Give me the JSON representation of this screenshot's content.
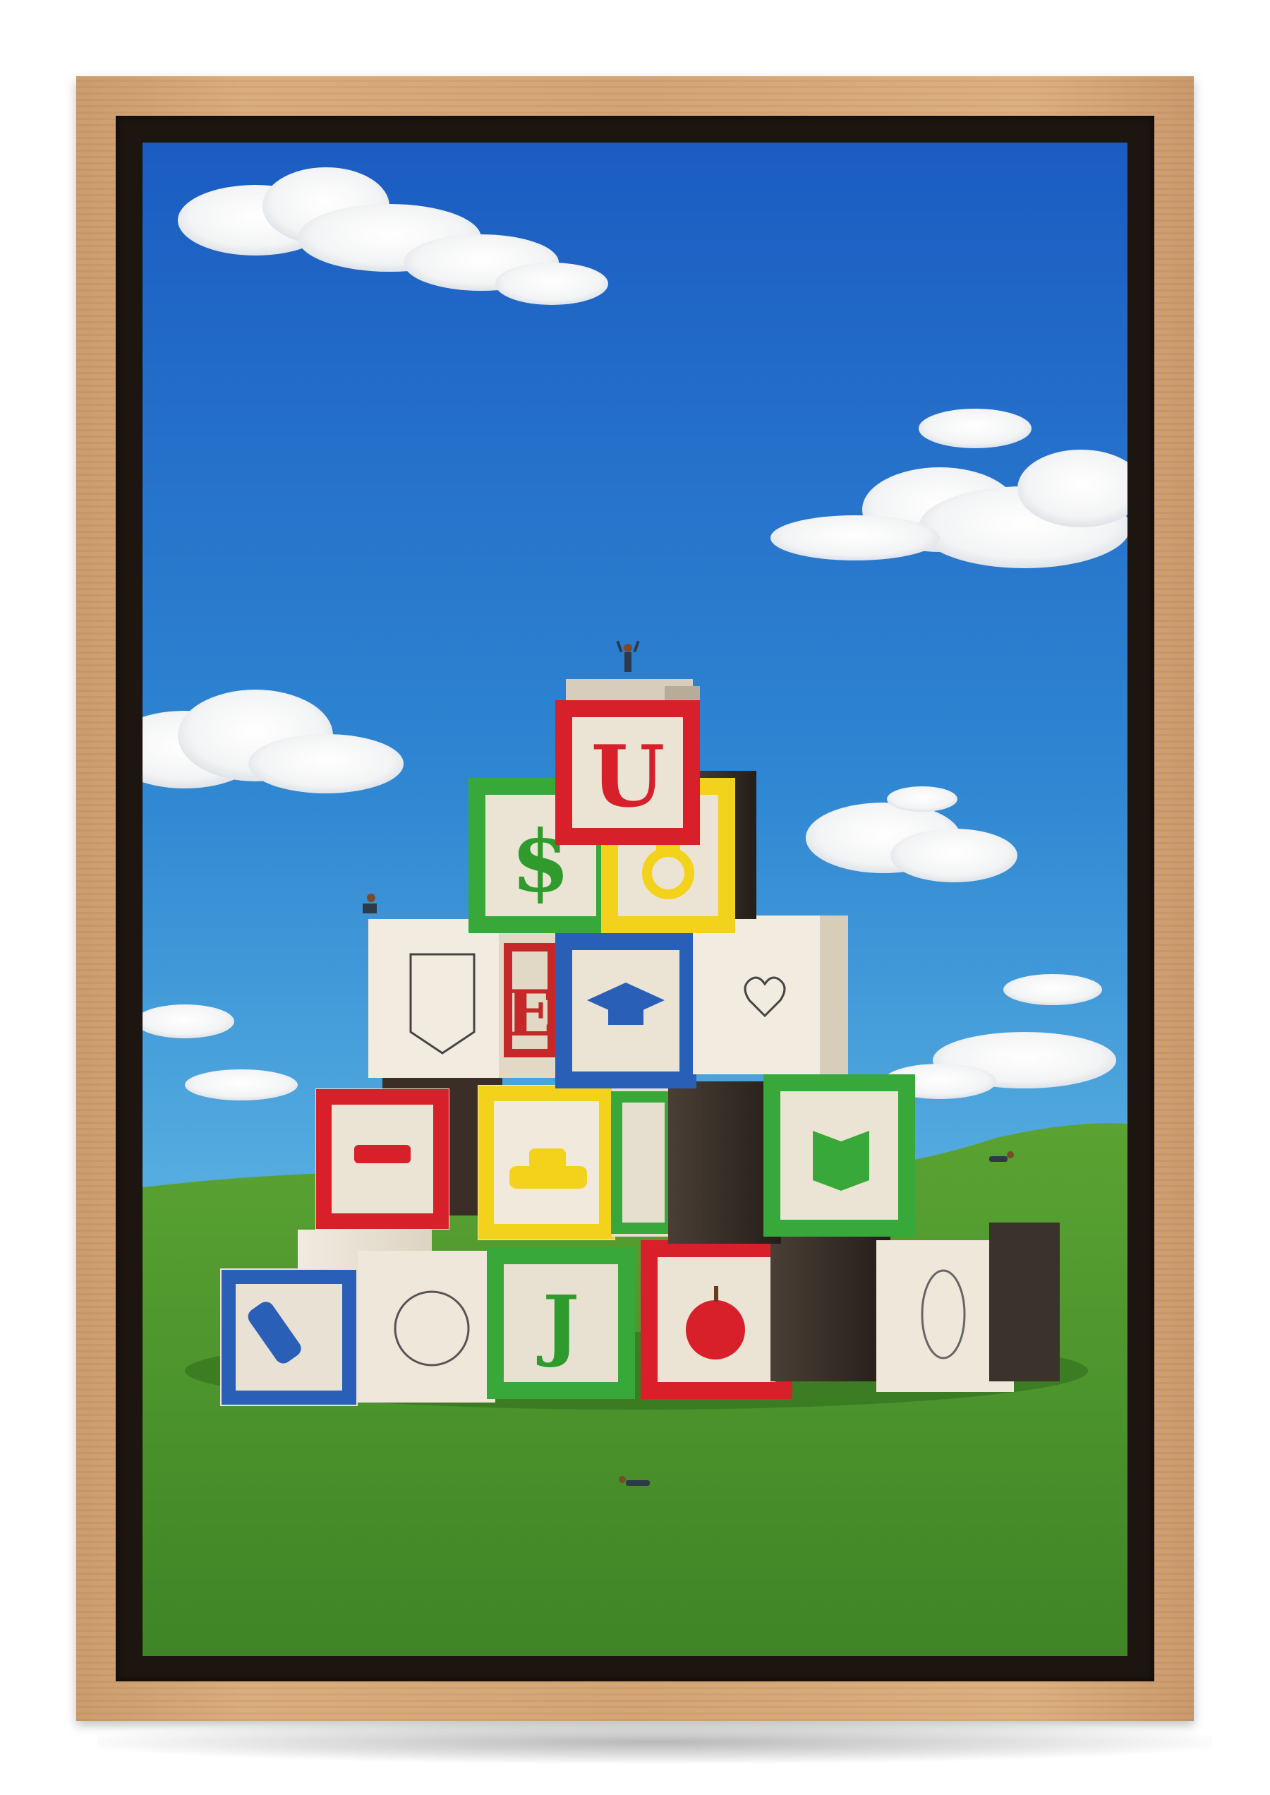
{
  "artwork": {
    "blocks": [
      {
        "id": "u",
        "glyph": "U",
        "color": "#d8202a"
      },
      {
        "id": "dollar",
        "glyph": "$",
        "color": "#2e9b2c"
      },
      {
        "id": "e",
        "glyph": "E",
        "color": "#c42828"
      },
      {
        "id": "j",
        "glyph": "J",
        "color": "#2e9b2c"
      }
    ],
    "colors": {
      "sky_top": "#1f63c6",
      "sky_bottom": "#4aa3de",
      "grass": "#4f9a2f",
      "frame": "#d5a676",
      "red": "#d8202a",
      "green": "#39a83a",
      "yellow": "#f3d21c",
      "blue": "#2a5fb8"
    }
  }
}
